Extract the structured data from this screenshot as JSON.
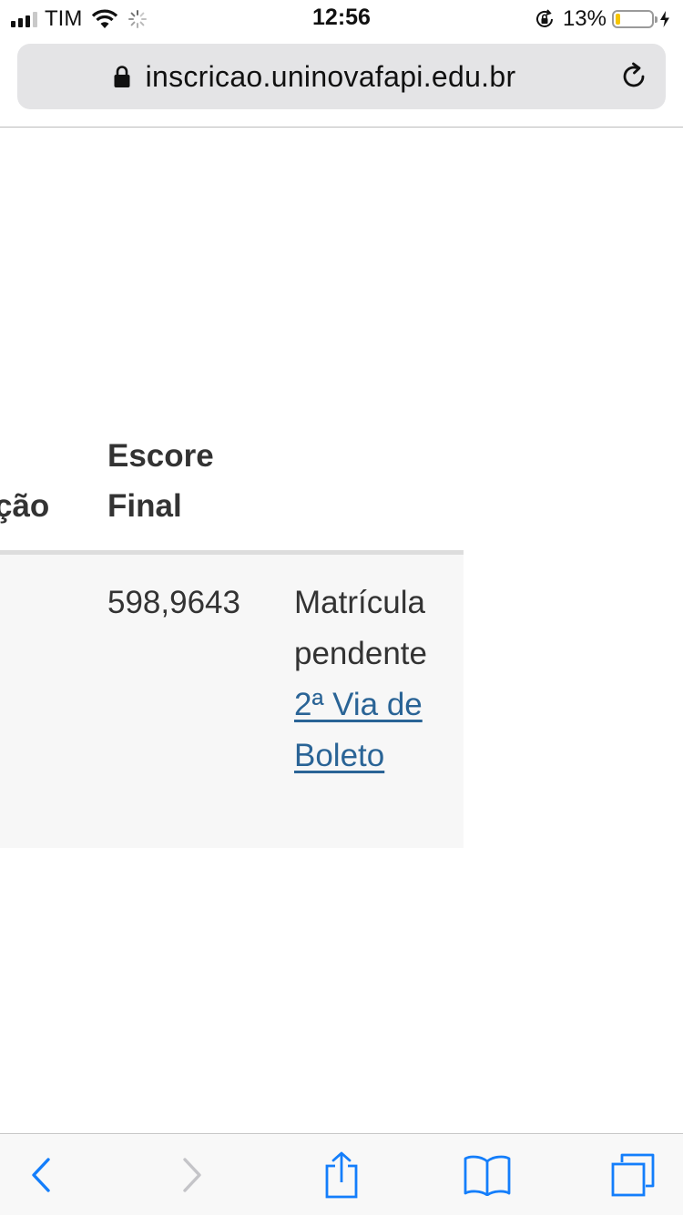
{
  "status_bar": {
    "carrier": "TIM",
    "time": "12:56",
    "battery_percent": "13%",
    "battery_level": 0.13,
    "battery_color": "#f6c500",
    "icons": [
      "signal-icon",
      "wifi-icon",
      "activity-spinner-icon",
      "rotation-lock-icon",
      "battery-icon",
      "charging-bolt-icon"
    ]
  },
  "address_bar": {
    "url": "inscricao.uninovafapi.edu.br",
    "icons": [
      "padlock-icon",
      "reload-icon"
    ]
  },
  "table": {
    "headers": {
      "partial_left": "ção",
      "escore_final": "Escore Final"
    },
    "row": {
      "score": "598,9643",
      "status": "Matrícula pendente",
      "link": "2ª Via de Boleto"
    },
    "link_color": "#2a6496"
  },
  "toolbar": {
    "accent_color": "#147efb",
    "disabled_color": "#c4c4c8",
    "buttons": [
      "back-icon",
      "forward-icon",
      "share-icon",
      "bookmarks-icon",
      "tabs-icon"
    ]
  }
}
